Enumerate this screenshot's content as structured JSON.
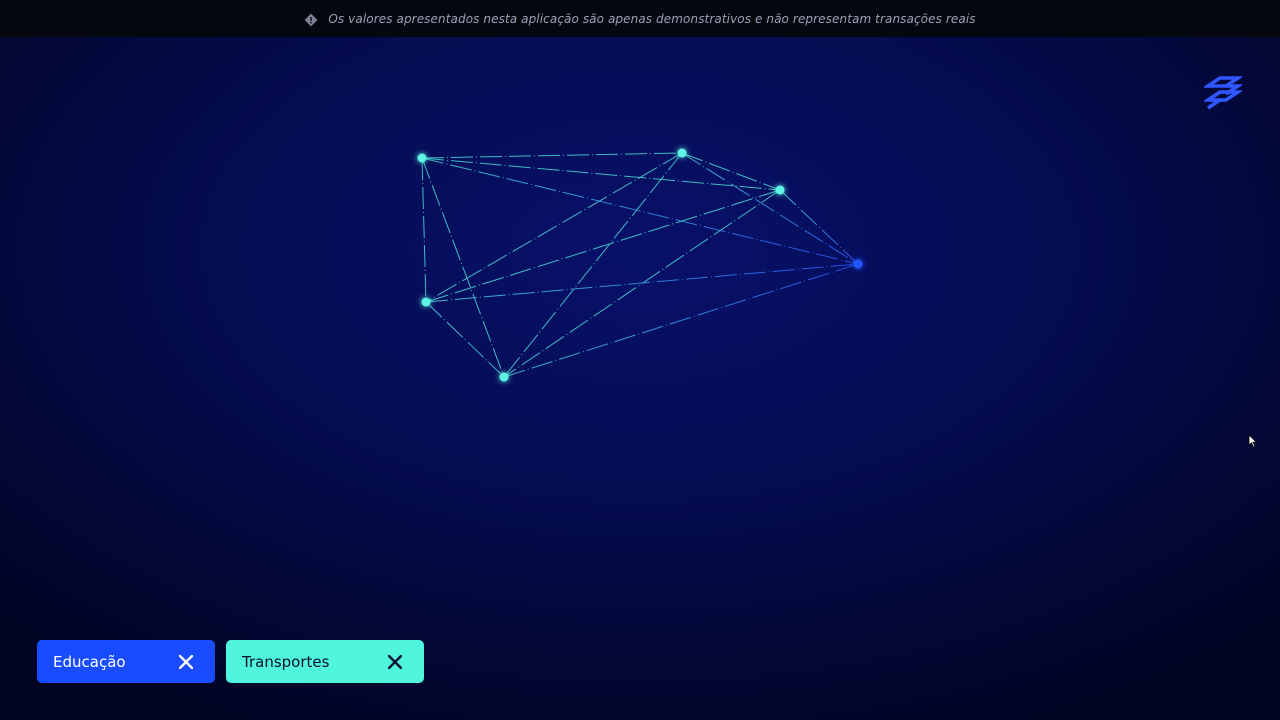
{
  "disclaimer": {
    "icon": "info-diamond-icon",
    "text": "Os valores apresentados nesta aplicação são apenas demonstrativos e não representam transações reais"
  },
  "logo": {
    "icon": "banco-do-brasil-logo-icon",
    "color": "#2f56ff"
  },
  "filters": [
    {
      "label": "Educação",
      "color": "#1a4cff",
      "remove_icon": "close-icon"
    },
    {
      "label": "Transportes",
      "color": "#4ff5dc",
      "remove_icon": "close-icon"
    }
  ],
  "colors": {
    "background": "#050c52",
    "node_cyan": "#5ff5e4",
    "node_blue": "#2456ff"
  }
}
